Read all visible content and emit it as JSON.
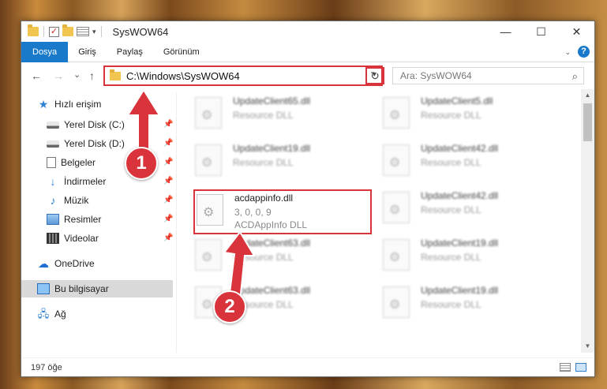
{
  "window": {
    "title": "SysWOW64",
    "controls": {
      "minimize": "—",
      "maximize": "☐",
      "close": "✕"
    }
  },
  "ribbon": {
    "tabs": [
      "Dosya",
      "Giriş",
      "Paylaş",
      "Görünüm"
    ],
    "help": "?"
  },
  "nav": {
    "back": "←",
    "forward": "→",
    "recent": "⌄",
    "up": "↑",
    "address": "C:\\Windows\\SysWOW64",
    "refresh": "↻",
    "search_placeholder": "Ara: SysWOW64"
  },
  "sidebar": {
    "items": [
      {
        "label": "Hızlı erişim",
        "icon": "star-icon"
      },
      {
        "label": "Yerel Disk (C:)",
        "icon": "disk-icon",
        "pinned": true
      },
      {
        "label": "Yerel Disk (D:)",
        "icon": "disk-icon",
        "pinned": true
      },
      {
        "label": "Belgeler",
        "icon": "document-icon",
        "pinned": true
      },
      {
        "label": "İndirmeler",
        "icon": "download-icon",
        "pinned": true
      },
      {
        "label": "Müzik",
        "icon": "music-icon",
        "pinned": true
      },
      {
        "label": "Resimler",
        "icon": "pictures-icon",
        "pinned": true
      },
      {
        "label": "Videolar",
        "icon": "video-icon",
        "pinned": true
      },
      {
        "label": "OneDrive",
        "icon": "cloud-icon"
      },
      {
        "label": "Bu bilgisayar",
        "icon": "computer-icon",
        "selected": true
      },
      {
        "label": "Ağ",
        "icon": "network-icon"
      }
    ]
  },
  "files": {
    "left": [
      {
        "name": "UpdateClient65.dll",
        "desc": "Resource DLL"
      },
      {
        "name": "UpdateClient19.dll",
        "desc": "Resource DLL"
      },
      {
        "name": "acdappinfo.dll",
        "version": "3, 0, 0, 9",
        "desc": "ACDAppInfo DLL",
        "highlighted": true
      },
      {
        "name": "UpdateClient63.dll",
        "desc": "Resource DLL"
      },
      {
        "name": "UpdateClient63.dll",
        "desc": "Resource DLL"
      }
    ],
    "right": [
      {
        "name": "UpdateClient5.dll",
        "desc": "Resource DLL"
      },
      {
        "name": "UpdateClient42.dll",
        "desc": "Resource DLL"
      },
      {
        "name": "UpdateClient42.dll",
        "desc": "Resource DLL"
      },
      {
        "name": "UpdateClient19.dll",
        "desc": "Resource DLL"
      },
      {
        "name": "UpdateClient19.dll",
        "desc": "Resource DLL"
      }
    ]
  },
  "status": {
    "item_count": "197 öğe"
  },
  "callouts": {
    "step1": "1",
    "step2": "2",
    "color": "#d9343b"
  }
}
